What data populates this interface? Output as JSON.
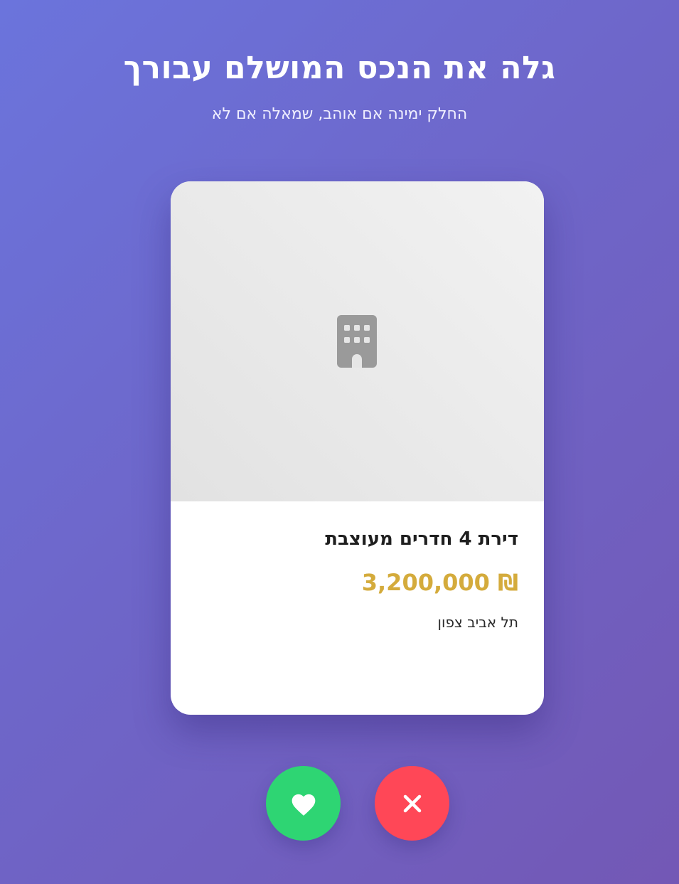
{
  "header": {
    "title": "גלה את הנכס המושלם עבורך",
    "subtitle": "החלק ימינה אם אוהב, שמאלה אם לא"
  },
  "property_card": {
    "image_icon": "building-icon",
    "title": "דירת 4 חדרים מעוצבת",
    "price": "₪ 3,200,000",
    "location": "תל אביב צפון"
  },
  "actions": {
    "like_icon": "heart-icon",
    "dislike_icon": "close-icon"
  },
  "colors": {
    "background_start": "#6b74dc",
    "background_end": "#7358b5",
    "price": "#d4ab3c",
    "like": "#2ed573",
    "dislike": "#ff4757"
  }
}
